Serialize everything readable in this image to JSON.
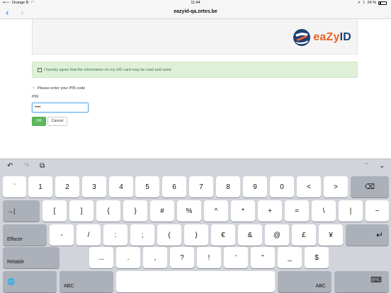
{
  "status_bar": {
    "carrier": "Orange B",
    "time": "11:44",
    "battery": "24 %"
  },
  "browser": {
    "url": "eazyid-qa.zetes.be"
  },
  "page": {
    "logo": {
      "prefix": "eaZy",
      "suffix": "ID"
    },
    "agree_text": "I hereby agree that the information on my eID card may be read and used.",
    "pin_prompt": "Please enter your PIN code",
    "pin_label": "PIN",
    "pin_value": "••••",
    "ok_label": "OK",
    "cancel_label": "Cancel"
  },
  "keyboard": {
    "row1": [
      "`",
      "1",
      "2",
      "3",
      "4",
      "5",
      "6",
      "7",
      "8",
      "9",
      "0",
      "<",
      ">"
    ],
    "row2": [
      "[",
      "]",
      "{",
      "}",
      "#",
      "%",
      "^",
      "*",
      "+",
      "=",
      "\\",
      "|",
      "~"
    ],
    "row3": [
      "-",
      "/",
      ":",
      ";",
      "(",
      ")",
      "€",
      "&",
      "@",
      "£",
      "¥"
    ],
    "row4": [
      "...",
      ".",
      ",",
      "?",
      "!",
      "'",
      "\"",
      "_",
      "$"
    ],
    "effacer_label": "Effacer",
    "retablir_label": "Rétablir",
    "abc_label": "ABC",
    "tab_glyph": "→|",
    "backspace_glyph": "⌫",
    "return_glyph": "↵",
    "globe_glyph": "🌐",
    "hide_glyph": "⌨",
    "undo_glyph": "↶",
    "redo_glyph": "↷",
    "paste_glyph": "⧉",
    "up_glyph": "⌃",
    "down_glyph": "⌄"
  },
  "colors": {
    "accent": "#1a7ef7",
    "success_bg": "#dff0d8",
    "success_text": "#3c763d",
    "ok_button": "#5cb85c",
    "logo_orange": "#e8622a",
    "logo_blue": "#1e3f73"
  }
}
